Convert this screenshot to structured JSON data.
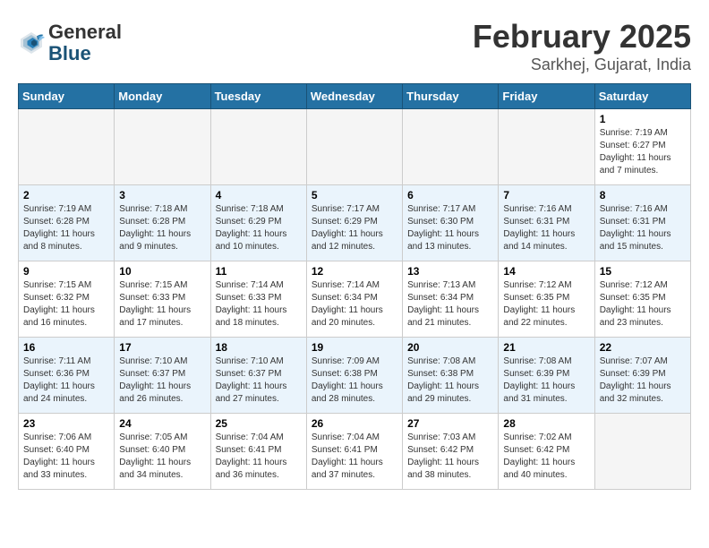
{
  "header": {
    "logo_line1": "General",
    "logo_line2": "Blue",
    "title": "February 2025",
    "subtitle": "Sarkhej, Gujarat, India"
  },
  "weekdays": [
    "Sunday",
    "Monday",
    "Tuesday",
    "Wednesday",
    "Thursday",
    "Friday",
    "Saturday"
  ],
  "weeks": [
    [
      {
        "day": "",
        "empty": true
      },
      {
        "day": "",
        "empty": true
      },
      {
        "day": "",
        "empty": true
      },
      {
        "day": "",
        "empty": true
      },
      {
        "day": "",
        "empty": true
      },
      {
        "day": "",
        "empty": true
      },
      {
        "day": "1",
        "sunrise": "7:19 AM",
        "sunset": "6:27 PM",
        "daylight": "11 hours and 7 minutes."
      }
    ],
    [
      {
        "day": "2",
        "sunrise": "7:19 AM",
        "sunset": "6:28 PM",
        "daylight": "11 hours and 8 minutes."
      },
      {
        "day": "3",
        "sunrise": "7:18 AM",
        "sunset": "6:28 PM",
        "daylight": "11 hours and 9 minutes."
      },
      {
        "day": "4",
        "sunrise": "7:18 AM",
        "sunset": "6:29 PM",
        "daylight": "11 hours and 10 minutes."
      },
      {
        "day": "5",
        "sunrise": "7:17 AM",
        "sunset": "6:29 PM",
        "daylight": "11 hours and 12 minutes."
      },
      {
        "day": "6",
        "sunrise": "7:17 AM",
        "sunset": "6:30 PM",
        "daylight": "11 hours and 13 minutes."
      },
      {
        "day": "7",
        "sunrise": "7:16 AM",
        "sunset": "6:31 PM",
        "daylight": "11 hours and 14 minutes."
      },
      {
        "day": "8",
        "sunrise": "7:16 AM",
        "sunset": "6:31 PM",
        "daylight": "11 hours and 15 minutes."
      }
    ],
    [
      {
        "day": "9",
        "sunrise": "7:15 AM",
        "sunset": "6:32 PM",
        "daylight": "11 hours and 16 minutes."
      },
      {
        "day": "10",
        "sunrise": "7:15 AM",
        "sunset": "6:33 PM",
        "daylight": "11 hours and 17 minutes."
      },
      {
        "day": "11",
        "sunrise": "7:14 AM",
        "sunset": "6:33 PM",
        "daylight": "11 hours and 18 minutes."
      },
      {
        "day": "12",
        "sunrise": "7:14 AM",
        "sunset": "6:34 PM",
        "daylight": "11 hours and 20 minutes."
      },
      {
        "day": "13",
        "sunrise": "7:13 AM",
        "sunset": "6:34 PM",
        "daylight": "11 hours and 21 minutes."
      },
      {
        "day": "14",
        "sunrise": "7:12 AM",
        "sunset": "6:35 PM",
        "daylight": "11 hours and 22 minutes."
      },
      {
        "day": "15",
        "sunrise": "7:12 AM",
        "sunset": "6:35 PM",
        "daylight": "11 hours and 23 minutes."
      }
    ],
    [
      {
        "day": "16",
        "sunrise": "7:11 AM",
        "sunset": "6:36 PM",
        "daylight": "11 hours and 24 minutes."
      },
      {
        "day": "17",
        "sunrise": "7:10 AM",
        "sunset": "6:37 PM",
        "daylight": "11 hours and 26 minutes."
      },
      {
        "day": "18",
        "sunrise": "7:10 AM",
        "sunset": "6:37 PM",
        "daylight": "11 hours and 27 minutes."
      },
      {
        "day": "19",
        "sunrise": "7:09 AM",
        "sunset": "6:38 PM",
        "daylight": "11 hours and 28 minutes."
      },
      {
        "day": "20",
        "sunrise": "7:08 AM",
        "sunset": "6:38 PM",
        "daylight": "11 hours and 29 minutes."
      },
      {
        "day": "21",
        "sunrise": "7:08 AM",
        "sunset": "6:39 PM",
        "daylight": "11 hours and 31 minutes."
      },
      {
        "day": "22",
        "sunrise": "7:07 AM",
        "sunset": "6:39 PM",
        "daylight": "11 hours and 32 minutes."
      }
    ],
    [
      {
        "day": "23",
        "sunrise": "7:06 AM",
        "sunset": "6:40 PM",
        "daylight": "11 hours and 33 minutes."
      },
      {
        "day": "24",
        "sunrise": "7:05 AM",
        "sunset": "6:40 PM",
        "daylight": "11 hours and 34 minutes."
      },
      {
        "day": "25",
        "sunrise": "7:04 AM",
        "sunset": "6:41 PM",
        "daylight": "11 hours and 36 minutes."
      },
      {
        "day": "26",
        "sunrise": "7:04 AM",
        "sunset": "6:41 PM",
        "daylight": "11 hours and 37 minutes."
      },
      {
        "day": "27",
        "sunrise": "7:03 AM",
        "sunset": "6:42 PM",
        "daylight": "11 hours and 38 minutes."
      },
      {
        "day": "28",
        "sunrise": "7:02 AM",
        "sunset": "6:42 PM",
        "daylight": "11 hours and 40 minutes."
      },
      {
        "day": "",
        "empty": true
      }
    ]
  ]
}
